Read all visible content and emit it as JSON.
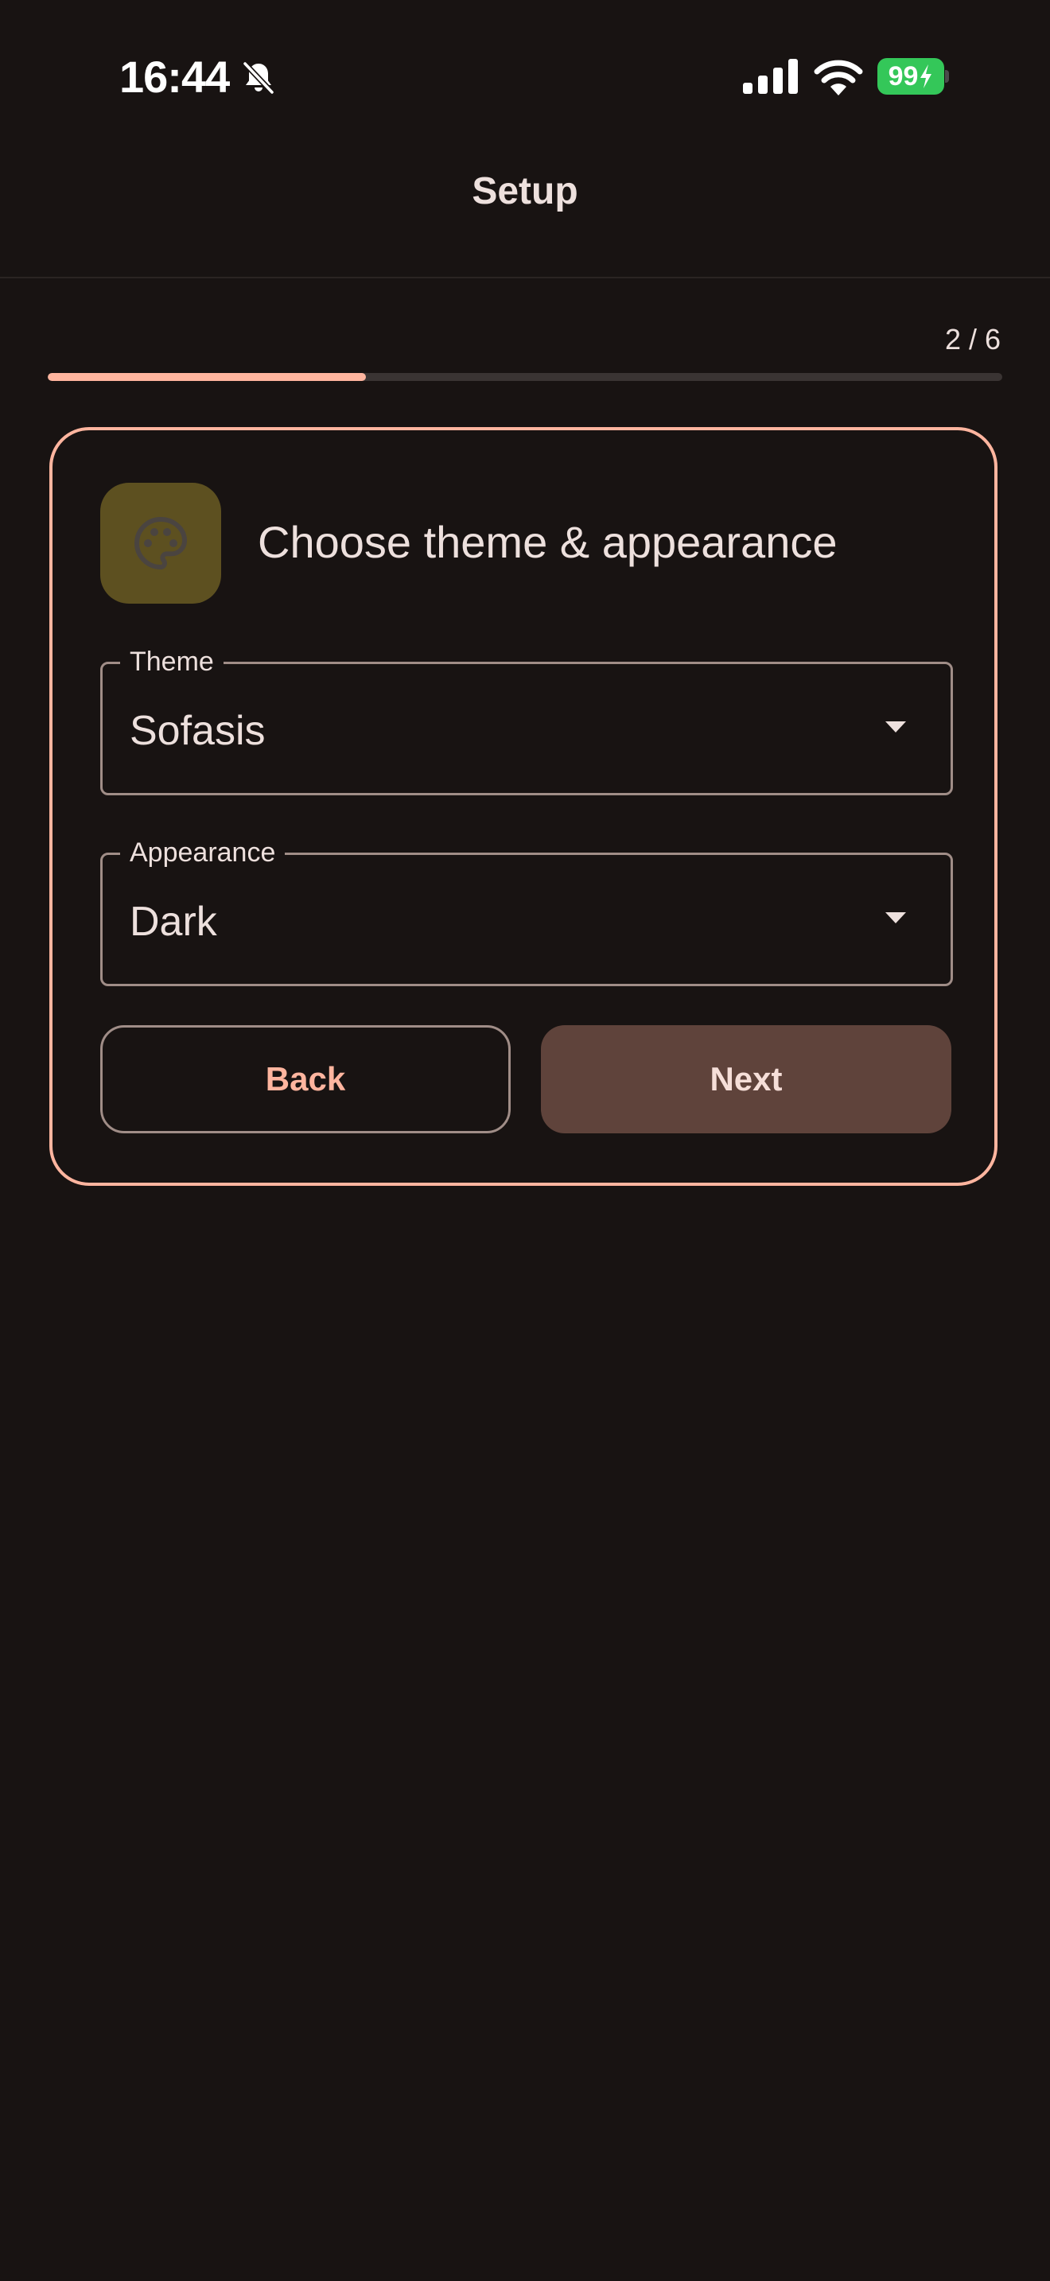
{
  "status_bar": {
    "time": "16:44",
    "battery": "99"
  },
  "app_bar": {
    "title": "Setup"
  },
  "progress": {
    "step_label": "2 / 6",
    "fraction": 0.333
  },
  "card": {
    "title": "Choose theme & appearance",
    "icon": "palette-icon",
    "theme_field": {
      "label": "Theme",
      "value": "Sofasis"
    },
    "appearance_field": {
      "label": "Appearance",
      "value": "Dark"
    },
    "back_label": "Back",
    "next_label": "Next"
  },
  "colors": {
    "accent": "#ffb59f",
    "background": "#181312",
    "next_button": "#5f433b",
    "icon_tile": "#5d5020",
    "battery": "#34c759"
  }
}
